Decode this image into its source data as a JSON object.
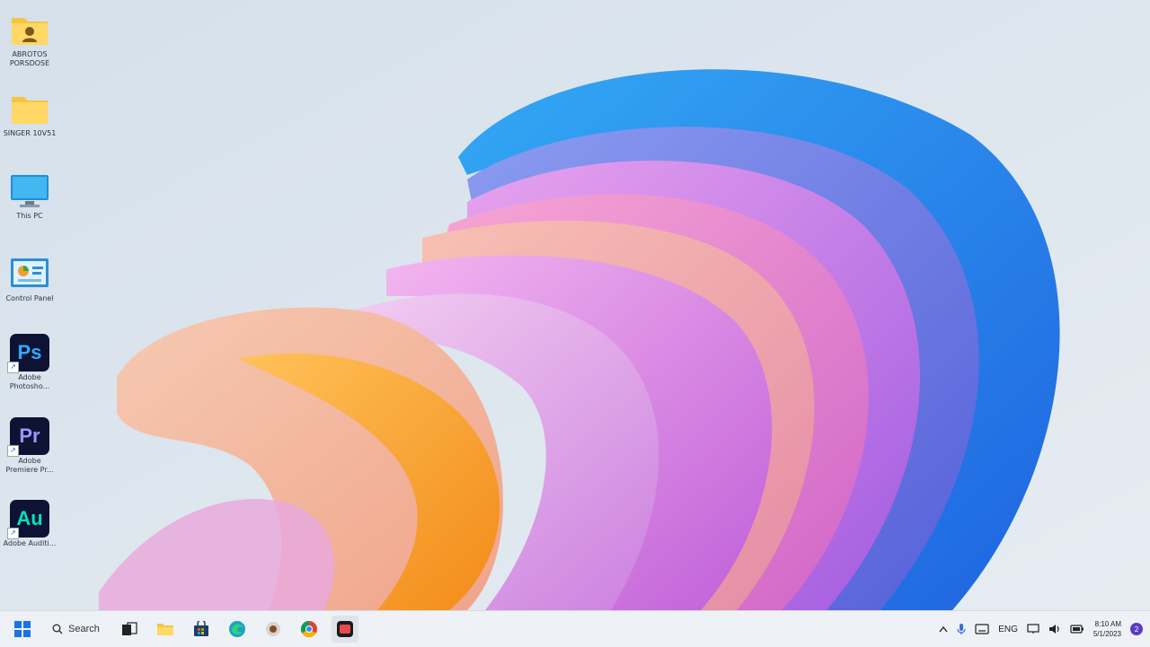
{
  "desktop": {
    "icons": [
      {
        "label": "ABROTOS PORSDOSE",
        "icon": "user-folder-icon"
      },
      {
        "label": "SINGER 10V51",
        "icon": "folder-icon"
      },
      {
        "label": "This PC",
        "icon": "monitor-icon"
      },
      {
        "label": "Control Panel",
        "icon": "control-panel-icon"
      },
      {
        "label": "Adobe Photosho...",
        "icon": "photoshop-icon",
        "badge": "Ps",
        "color": "#31a8ff"
      },
      {
        "label": "Adobe Premiere Pr...",
        "icon": "premiere-icon",
        "badge": "Pr",
        "color": "#9999ff"
      },
      {
        "label": "Adobe Auditi...",
        "icon": "audition-icon",
        "badge": "Au",
        "color": "#00e4bb"
      }
    ]
  },
  "taskbar": {
    "search_label": "Search",
    "language": "ENG",
    "time": "8:10 AM",
    "date": "5/1/2023",
    "notification_count": "2"
  }
}
